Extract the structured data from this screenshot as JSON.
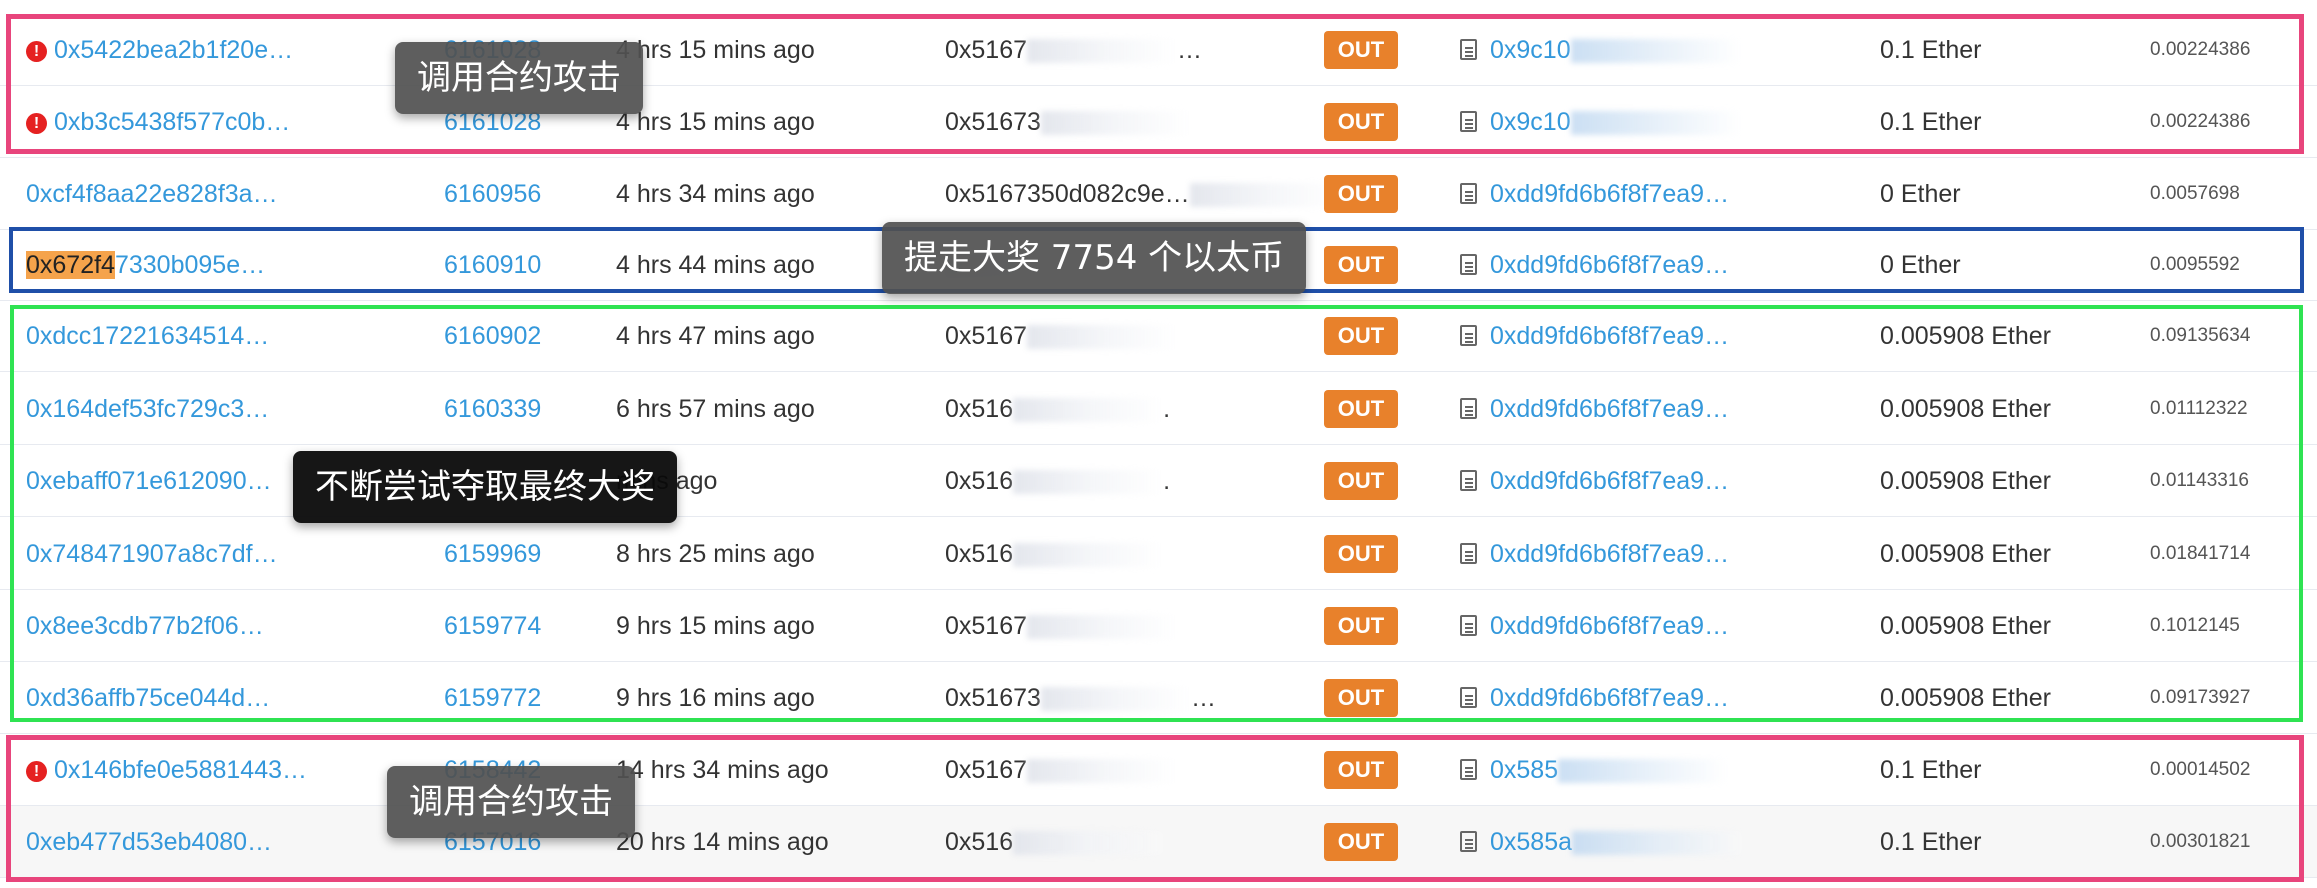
{
  "rows": [
    {
      "error": true,
      "txhash": "0x5422bea2b1f20e…",
      "block": "6161028",
      "age": "4 hrs 15 mins ago",
      "from": "0x5167",
      "from_tail": "…",
      "direction": "OUT",
      "to": "0x9c10",
      "to_tail": "",
      "value": "0.1 Ether",
      "fee": "0.00224386"
    },
    {
      "error": true,
      "txhash": "0xb3c5438f577c0b…",
      "block": "6161028",
      "age": "4 hrs 15 mins ago",
      "from": "0x51673",
      "from_tail": "",
      "direction": "OUT",
      "to": "0x9c10",
      "to_tail": "",
      "value": "0.1 Ether",
      "fee": "0.00224386"
    },
    {
      "error": false,
      "txhash": "0xcf4f8aa22e828f3a…",
      "block": "6160956",
      "age": "4 hrs 34 mins ago",
      "from": "0x5167350d082c9e…",
      "from_tail": "",
      "direction": "OUT",
      "to": "0xdd9fd6b6f8f7ea9…",
      "to_tail": "",
      "value": "0 Ether",
      "fee": "0.0057698"
    },
    {
      "error": false,
      "txhash": "0x672f47330b095e…",
      "block": "6160910",
      "age": "4 hrs 44 mins ago",
      "from": "",
      "from_tail": "",
      "direction": "OUT",
      "to": "0xdd9fd6b6f8f7ea9…",
      "to_tail": "",
      "value": "0 Ether",
      "fee": "0.0095592"
    },
    {
      "error": false,
      "txhash": "0xdcc17221634514…",
      "block": "6160902",
      "age": "4 hrs 47 mins ago",
      "from": "0x5167",
      "from_tail": "",
      "direction": "OUT",
      "to": "0xdd9fd6b6f8f7ea9…",
      "to_tail": "",
      "value": "0.005908 Ether",
      "fee": "0.09135634"
    },
    {
      "error": false,
      "txhash": "0x164def53fc729c3…",
      "block": "6160339",
      "age": "6 hrs 57 mins ago",
      "from": "0x516",
      "from_tail": ".",
      "direction": "OUT",
      "to": "0xdd9fd6b6f8f7ea9…",
      "to_tail": "",
      "value": "0.005908 Ether",
      "fee": "0.01112322"
    },
    {
      "error": false,
      "txhash": "0xebaff071e612090…",
      "block": "",
      "age": "mins ago",
      "from": "0x516",
      "from_tail": ".",
      "direction": "OUT",
      "to": "0xdd9fd6b6f8f7ea9…",
      "to_tail": "",
      "value": "0.005908 Ether",
      "fee": "0.01143316"
    },
    {
      "error": false,
      "txhash": "0x748471907a8c7df…",
      "block": "6159969",
      "age": "8 hrs 25 mins ago",
      "from": "0x516",
      "from_tail": "",
      "direction": "OUT",
      "to": "0xdd9fd6b6f8f7ea9…",
      "to_tail": "",
      "value": "0.005908 Ether",
      "fee": "0.01841714"
    },
    {
      "error": false,
      "txhash": "0x8ee3cdb77b2f06…",
      "block": "6159774",
      "age": "9 hrs 15 mins ago",
      "from": "0x5167",
      "from_tail": "",
      "direction": "OUT",
      "to": "0xdd9fd6b6f8f7ea9…",
      "to_tail": "",
      "value": "0.005908 Ether",
      "fee": "0.1012145"
    },
    {
      "error": false,
      "txhash": "0xd36affb75ce044d…",
      "block": "6159772",
      "age": "9 hrs 16 mins ago",
      "from": "0x51673",
      "from_tail": "…",
      "direction": "OUT",
      "to": "0xdd9fd6b6f8f7ea9…",
      "to_tail": "",
      "value": "0.005908 Ether",
      "fee": "0.09173927"
    },
    {
      "error": true,
      "txhash": "0x146bfe0e5881443…",
      "block": "6158442",
      "age": "14 hrs 34 mins ago",
      "from": "0x5167",
      "from_tail": "",
      "direction": "OUT",
      "to": "0x585",
      "to_tail": "",
      "value": "0.1 Ether",
      "fee": "0.00014502"
    },
    {
      "error": false,
      "txhash": "0xeb477d53eb4080…",
      "block": "6157016",
      "age": "20 hrs 14 mins ago",
      "from": "0x516",
      "from_tail": "",
      "direction": "OUT",
      "to": "0x585a",
      "to_tail": "",
      "value": "0.1 Ether",
      "fee": "0.00301821"
    }
  ],
  "highlight_prefix": "0x672f4",
  "annotations": {
    "attack_call_top": "调用合约攻击",
    "withdraw_jackpot": "提走大奖 7754 个以太币",
    "keep_trying": "不断尝试夺取最终大奖",
    "attack_call_bottom": "调用合约攻击"
  },
  "colors": {
    "link": "#3498db",
    "out_badge": "#e8812b",
    "error_icon": "#e52121",
    "frame_attack": "#e8457c",
    "frame_jackpot": "#1f4fa8",
    "frame_attempts": "#2fe352"
  },
  "icons": {
    "error": "exclamation-circle-icon",
    "contract": "file-contract-icon"
  }
}
